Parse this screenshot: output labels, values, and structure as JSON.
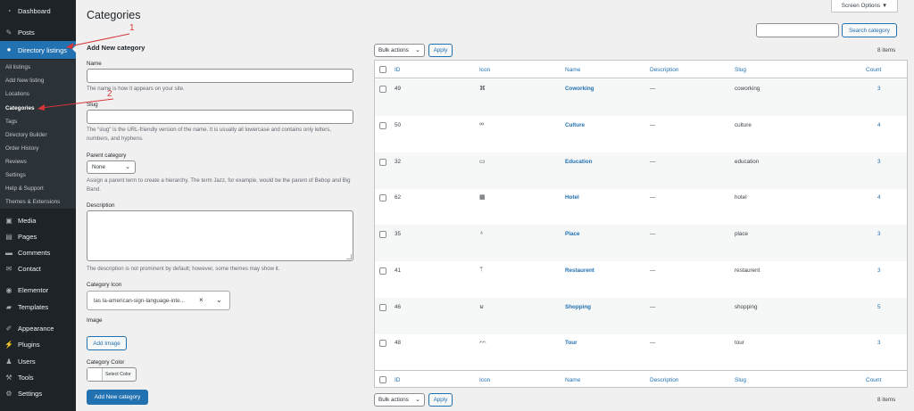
{
  "sidebar": {
    "top_items": [
      {
        "label": "Dashboard",
        "icon": "dashboard-icon",
        "glyph": "◔"
      },
      {
        "label": "Posts",
        "icon": "pin-icon",
        "glyph": "✎"
      },
      {
        "label": "Directory listings",
        "icon": "map-pin-icon",
        "glyph": "●"
      }
    ],
    "submenu": [
      {
        "label": "All listings"
      },
      {
        "label": "Add New listing"
      },
      {
        "label": "Locations"
      },
      {
        "label": "Categories"
      },
      {
        "label": "Tags"
      },
      {
        "label": "Directory Builder"
      },
      {
        "label": "Order History"
      },
      {
        "label": "Reviews"
      },
      {
        "label": "Settings"
      },
      {
        "label": "Help & Support"
      },
      {
        "label": "Themes & Extensions"
      }
    ],
    "bottom_items": [
      {
        "label": "Media",
        "icon": "media-icon",
        "glyph": "▣"
      },
      {
        "label": "Pages",
        "icon": "pages-icon",
        "glyph": "▤"
      },
      {
        "label": "Comments",
        "icon": "comments-icon",
        "glyph": "▬"
      },
      {
        "label": "Contact",
        "icon": "mail-icon",
        "glyph": "✉"
      },
      {
        "label": "Elementor",
        "icon": "elementor-icon",
        "glyph": "◉"
      },
      {
        "label": "Templates",
        "icon": "folder-icon",
        "glyph": "▰"
      },
      {
        "label": "Appearance",
        "icon": "brush-icon",
        "glyph": "✐"
      },
      {
        "label": "Plugins",
        "icon": "plugins-icon",
        "glyph": "⚡"
      },
      {
        "label": "Users",
        "icon": "users-icon",
        "glyph": "♟"
      },
      {
        "label": "Tools",
        "icon": "wrench-icon",
        "glyph": "⚒"
      },
      {
        "label": "Settings",
        "icon": "settings-icon",
        "glyph": "⚙"
      }
    ]
  },
  "header": {
    "title": "Categories",
    "screen_options": "Screen Options ▼"
  },
  "form": {
    "heading": "Add New category",
    "name_label": "Name",
    "name_value": "",
    "name_help": "The name is how it appears on your site.",
    "slug_label": "Slug",
    "slug_value": "",
    "slug_help": "The “slug” is the URL-friendly version of the name. It is usually all lowercase and contains only letters, numbers, and hyphens.",
    "parent_label": "Parent category",
    "parent_value": "None",
    "parent_help": "Assign a parent term to create a hierarchy. The term Jazz, for example, would be the parent of Bebop and Big Band.",
    "description_label": "Description",
    "description_help": "The description is not prominent by default; however, some themes may show it.",
    "icon_label": "Category Icon",
    "icon_value": "las la-american-sign-language-inte...",
    "image_label": "Image",
    "add_image": "Add Image",
    "color_label": "Category Color",
    "color_button": "Select Color",
    "submit": "Add New category"
  },
  "search": {
    "placeholder": "",
    "button": "Search category"
  },
  "bulk": {
    "label": "Bulk actions",
    "apply": "Apply",
    "items_count": "8 items"
  },
  "table": {
    "columns": [
      "ID",
      "Icon",
      "Name",
      "Description",
      "Slug",
      "Count"
    ],
    "rows": [
      {
        "id": "49",
        "icon": "⌘",
        "name": "Coworking",
        "description": "—",
        "slug": "coworking",
        "count": "3"
      },
      {
        "id": "50",
        "icon": "∞",
        "name": "Culture",
        "description": "—",
        "slug": "culture",
        "count": "4"
      },
      {
        "id": "32",
        "icon": "▭",
        "name": "Education",
        "description": "—",
        "slug": "education",
        "count": "3"
      },
      {
        "id": "62",
        "icon": "▦",
        "name": "Hotel",
        "description": "—",
        "slug": "hotel",
        "count": "4"
      },
      {
        "id": "35",
        "icon": "♁",
        "name": "Place",
        "description": "—",
        "slug": "place",
        "count": "3"
      },
      {
        "id": "41",
        "icon": "ᛘ",
        "name": "Restaurent",
        "description": "—",
        "slug": "restaurent",
        "count": "3"
      },
      {
        "id": "46",
        "icon": "⊌",
        "name": "Shopping",
        "description": "—",
        "slug": "shopping",
        "count": "5"
      },
      {
        "id": "48",
        "icon": "ᨓ",
        "name": "Tour",
        "description": "—",
        "slug": "tour",
        "count": "3"
      }
    ]
  },
  "annotations": {
    "marker_1": "1",
    "marker_2": "2"
  }
}
